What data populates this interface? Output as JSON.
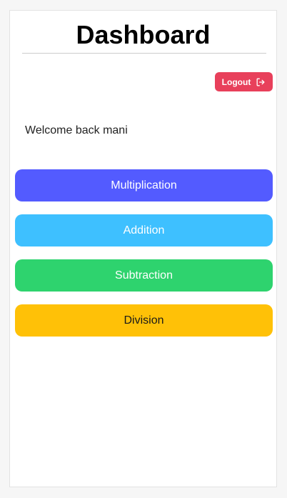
{
  "header": {
    "title": "Dashboard"
  },
  "logout": {
    "label": "Logout",
    "icon": "logout-icon",
    "color": "#e8405b"
  },
  "welcome": {
    "text": "Welcome back mani"
  },
  "operations": [
    {
      "label": "Multiplication",
      "color": "#535bff",
      "text_color": "#ffffff"
    },
    {
      "label": "Addition",
      "color": "#3ec0ff",
      "text_color": "#ffffff"
    },
    {
      "label": "Subtraction",
      "color": "#2ed36e",
      "text_color": "#ffffff"
    },
    {
      "label": "Division",
      "color": "#ffc107",
      "text_color": "#1a1a1a"
    }
  ]
}
